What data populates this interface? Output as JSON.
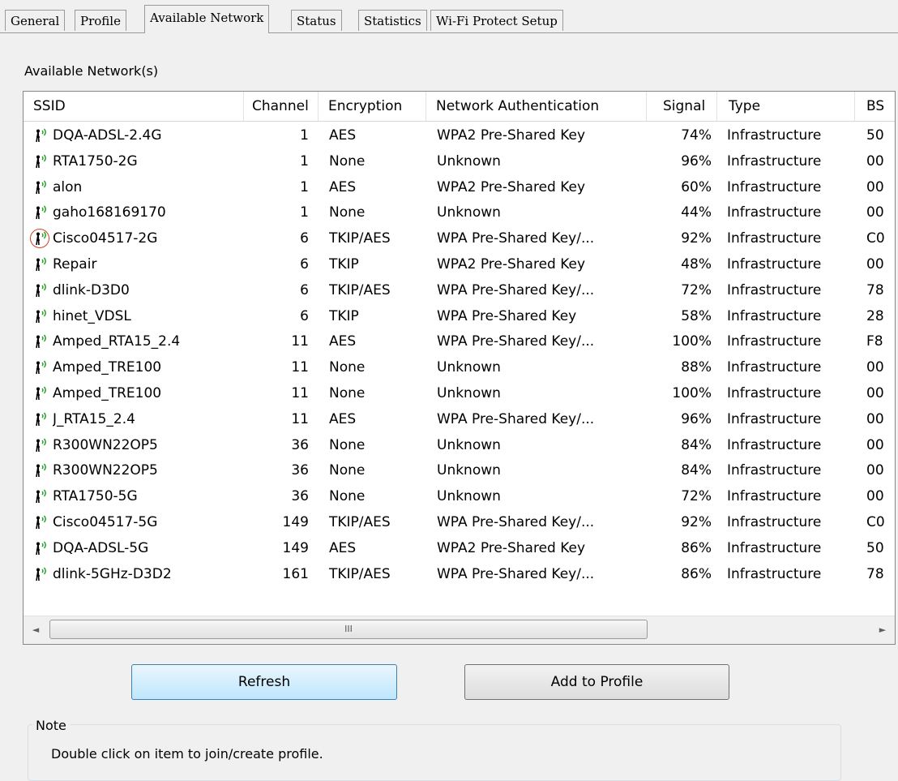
{
  "tabs": [
    {
      "label": "General",
      "active": false
    },
    {
      "label": "Profile",
      "active": false
    },
    {
      "label": "Available Network",
      "active": true
    },
    {
      "label": "Status",
      "active": false
    },
    {
      "label": "Statistics",
      "active": false
    },
    {
      "label": "Wi-Fi Protect Setup",
      "active": false
    }
  ],
  "section_title": "Available Network(s)",
  "columns": {
    "ssid": "SSID",
    "channel": "Channel",
    "encryption": "Encryption",
    "auth": "Network Authentication",
    "signal": "Signal",
    "type": "Type",
    "bssid": "BS"
  },
  "networks": [
    {
      "ssid": "DQA-ADSL-2.4G",
      "channel": "1",
      "encryption": "AES",
      "auth": "WPA2 Pre-Shared Key",
      "signal": "74%",
      "type": "Infrastructure",
      "bssid": "50",
      "connected": false
    },
    {
      "ssid": "RTA1750-2G",
      "channel": "1",
      "encryption": "None",
      "auth": "Unknown",
      "signal": "96%",
      "type": "Infrastructure",
      "bssid": "00",
      "connected": false
    },
    {
      "ssid": "alon",
      "channel": "1",
      "encryption": "AES",
      "auth": "WPA2 Pre-Shared Key",
      "signal": "60%",
      "type": "Infrastructure",
      "bssid": "00",
      "connected": false
    },
    {
      "ssid": "gaho168169170",
      "channel": "1",
      "encryption": "None",
      "auth": "Unknown",
      "signal": "44%",
      "type": "Infrastructure",
      "bssid": "00",
      "connected": false
    },
    {
      "ssid": "Cisco04517-2G",
      "channel": "6",
      "encryption": "TKIP/AES",
      "auth": "WPA Pre-Shared Key/...",
      "signal": "92%",
      "type": "Infrastructure",
      "bssid": "C0",
      "connected": true
    },
    {
      "ssid": "Repair",
      "channel": "6",
      "encryption": "TKIP",
      "auth": "WPA2 Pre-Shared Key",
      "signal": "48%",
      "type": "Infrastructure",
      "bssid": "00",
      "connected": false
    },
    {
      "ssid": "dlink-D3D0",
      "channel": "6",
      "encryption": "TKIP/AES",
      "auth": "WPA Pre-Shared Key/...",
      "signal": "72%",
      "type": "Infrastructure",
      "bssid": "78",
      "connected": false
    },
    {
      "ssid": "hinet_VDSL",
      "channel": "6",
      "encryption": "TKIP",
      "auth": "WPA Pre-Shared Key",
      "signal": "58%",
      "type": "Infrastructure",
      "bssid": "28",
      "connected": false
    },
    {
      "ssid": "Amped_RTA15_2.4",
      "channel": "11",
      "encryption": "AES",
      "auth": "WPA Pre-Shared Key/...",
      "signal": "100%",
      "type": "Infrastructure",
      "bssid": "F8",
      "connected": false
    },
    {
      "ssid": "Amped_TRE100",
      "channel": "11",
      "encryption": "None",
      "auth": "Unknown",
      "signal": "88%",
      "type": "Infrastructure",
      "bssid": "00",
      "connected": false
    },
    {
      "ssid": "Amped_TRE100",
      "channel": "11",
      "encryption": "None",
      "auth": "Unknown",
      "signal": "100%",
      "type": "Infrastructure",
      "bssid": "00",
      "connected": false
    },
    {
      "ssid": "J_RTA15_2.4",
      "channel": "11",
      "encryption": "AES",
      "auth": "WPA Pre-Shared Key/...",
      "signal": "96%",
      "type": "Infrastructure",
      "bssid": "00",
      "connected": false
    },
    {
      "ssid": "R300WN22OP5",
      "channel": "36",
      "encryption": "None",
      "auth": "Unknown",
      "signal": "84%",
      "type": "Infrastructure",
      "bssid": "00",
      "connected": false
    },
    {
      "ssid": "R300WN22OP5",
      "channel": "36",
      "encryption": "None",
      "auth": "Unknown",
      "signal": "84%",
      "type": "Infrastructure",
      "bssid": "00",
      "connected": false
    },
    {
      "ssid": "RTA1750-5G",
      "channel": "36",
      "encryption": "None",
      "auth": "Unknown",
      "signal": "72%",
      "type": "Infrastructure",
      "bssid": "00",
      "connected": false
    },
    {
      "ssid": "Cisco04517-5G",
      "channel": "149",
      "encryption": "TKIP/AES",
      "auth": "WPA Pre-Shared Key/...",
      "signal": "92%",
      "type": "Infrastructure",
      "bssid": "C0",
      "connected": false
    },
    {
      "ssid": "DQA-ADSL-5G",
      "channel": "149",
      "encryption": "AES",
      "auth": "WPA2 Pre-Shared Key",
      "signal": "86%",
      "type": "Infrastructure",
      "bssid": "50",
      "connected": false
    },
    {
      "ssid": "dlink-5GHz-D3D2",
      "channel": "161",
      "encryption": "TKIP/AES",
      "auth": "WPA Pre-Shared Key/...",
      "signal": "86%",
      "type": "Infrastructure",
      "bssid": "78",
      "connected": false
    }
  ],
  "scrollbar": {
    "left_arrow": "◄",
    "right_arrow": "►",
    "grip": "III"
  },
  "buttons": {
    "refresh": "Refresh",
    "add_to_profile": "Add to Profile"
  },
  "note": {
    "legend": "Note",
    "text": "Double click on item to join/create profile."
  },
  "icons": {
    "network": "wifi-antenna-icon"
  },
  "colors": {
    "connected_marker": "#d04020",
    "refresh_button": "#bee6fd"
  }
}
